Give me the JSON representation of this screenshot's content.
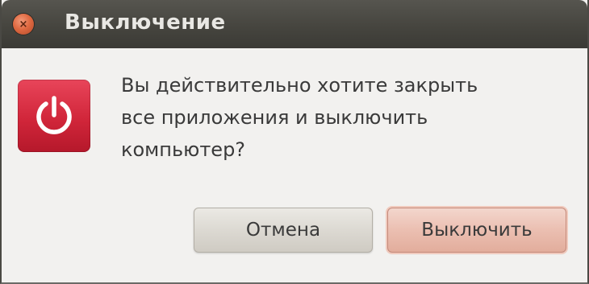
{
  "window": {
    "title": "Выключение",
    "close_icon": "close-icon"
  },
  "dialog": {
    "icon": "power-icon",
    "message_lines": [
      "Вы действительно хотите закрыть",
      "все приложения и выключить",
      "компьютер?"
    ]
  },
  "buttons": {
    "cancel_label": "Отмена",
    "shutdown_label": "Выключить"
  },
  "colors": {
    "titlebar": "#46453f",
    "accent_red": "#d1263a",
    "background": "#f2f1ef"
  }
}
